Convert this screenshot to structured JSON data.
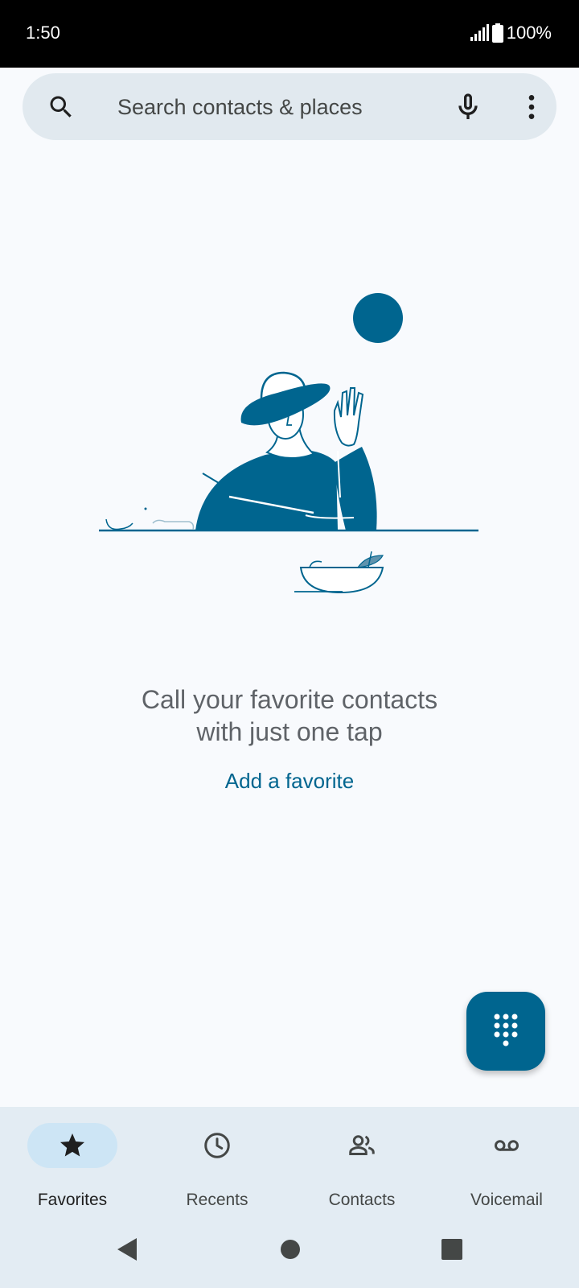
{
  "status_bar": {
    "time": "1:50",
    "battery": "100%"
  },
  "search": {
    "placeholder": "Search contacts & places"
  },
  "empty_state": {
    "line1": "Call your favorite contacts",
    "line2": "with just one tap",
    "action": "Add a favorite"
  },
  "nav": {
    "items": [
      {
        "label": "Favorites",
        "icon": "star-icon",
        "active": true
      },
      {
        "label": "Recents",
        "icon": "clock-icon",
        "active": false
      },
      {
        "label": "Contacts",
        "icon": "people-icon",
        "active": false
      },
      {
        "label": "Voicemail",
        "icon": "voicemail-icon",
        "active": false
      }
    ]
  },
  "colors": {
    "accent": "#00658f",
    "nav_background": "#e3ecf3",
    "search_background": "#e1e9ef",
    "page_background": "#f8fafd"
  }
}
